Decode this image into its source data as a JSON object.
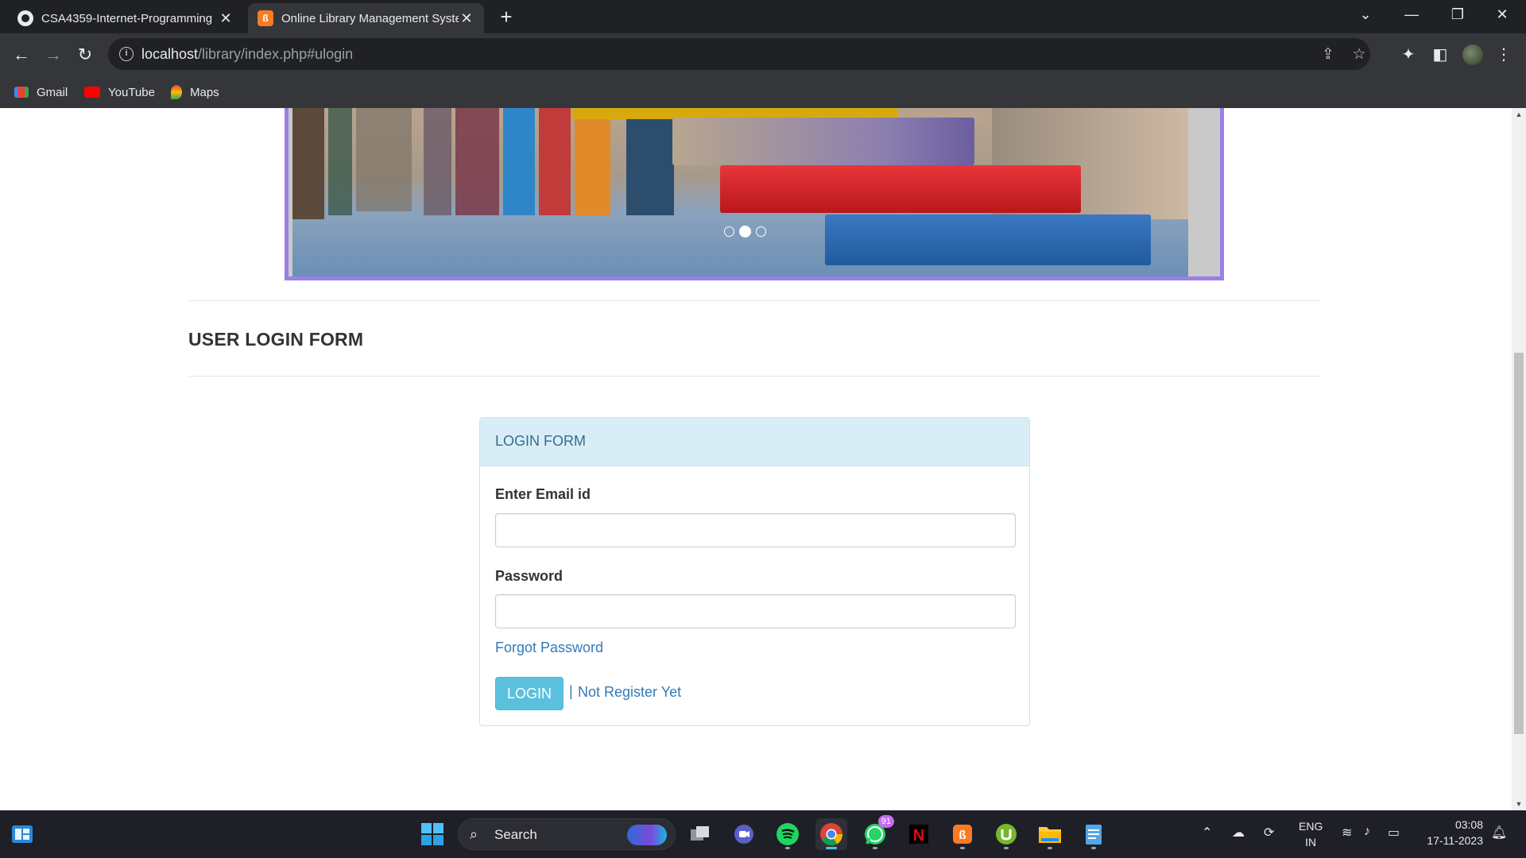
{
  "browser": {
    "tabs": [
      {
        "title": "CSA4359-Internet-Programming",
        "favicon": "github-icon",
        "active": false
      },
      {
        "title": "Online Library Management System",
        "favicon": "xampp-icon",
        "active": true
      }
    ],
    "url": {
      "host": "localhost",
      "path": "/library/index.php#ulogin"
    },
    "bookmarks": [
      {
        "label": "Gmail",
        "icon": "gmail-icon"
      },
      {
        "label": "YouTube",
        "icon": "youtube-icon"
      },
      {
        "label": "Maps",
        "icon": "maps-icon"
      }
    ]
  },
  "page": {
    "section_title": "USER LOGIN FORM",
    "carousel": {
      "slide_count": 3,
      "active_slide": 2
    }
  },
  "login_form": {
    "heading": "LOGIN FORM",
    "email_label": "Enter Email id",
    "email_value": "",
    "password_label": "Password",
    "password_value": "",
    "forgot_link": "Forgot Password",
    "login_button": "LOGIN",
    "separator": "|",
    "register_link": "Not Register Yet"
  },
  "taskbar": {
    "search_label": "Search",
    "whatsapp_badge": "91",
    "language": {
      "line1": "ENG",
      "line2": "IN"
    },
    "time": "03:08",
    "date": "17-11-2023"
  },
  "colors": {
    "panel_heading_bg": "#d9edf7",
    "panel_border": "#bce8f1",
    "button_info": "#5bc0de",
    "link": "#337ab7",
    "carousel_border": "#9b7fe6"
  }
}
